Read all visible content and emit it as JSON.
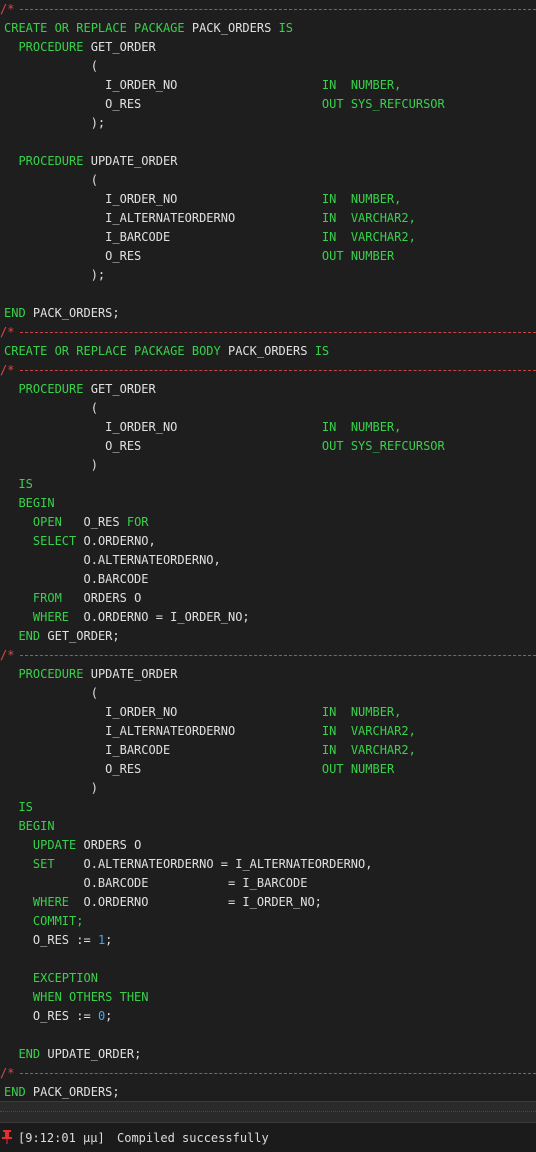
{
  "separator_text": "/*",
  "code": {
    "pkg_header": "CREATE OR REPLACE PACKAGE",
    "pkg_name": "PACK_ORDERS",
    "is": "IS",
    "procedure": "PROCEDURE",
    "get_order": "GET_ORDER",
    "update_order": "UPDATE_ORDER",
    "open_paren": "(",
    "close_paren": ")",
    "close_paren_semi": ");",
    "p_order_no": "I_ORDER_NO",
    "p_o_res": "O_RES",
    "p_alt": "I_ALTERNATEORDERNO",
    "p_barcode": "I_BARCODE",
    "in": "IN",
    "out": "OUT",
    "number_comma": "NUMBER,",
    "number": "NUMBER",
    "varchar2_comma": "VARCHAR2,",
    "sys_refcursor": "SYS_REFCURSOR",
    "end": "END",
    "pack_orders_semi": "PACK_ORDERS;",
    "pkg_body_header": "CREATE OR REPLACE PACKAGE BODY",
    "begin": "BEGIN",
    "open": "OPEN",
    "for": "FOR",
    "select": "SELECT",
    "o_orderno_comma": "O.ORDERNO,",
    "o_alt_comma": "O.ALTERNATEORDERNO,",
    "o_barcode": "O.BARCODE",
    "from": "FROM",
    "orders_o": "ORDERS O",
    "where": "WHERE",
    "where_cond": "O.ORDERNO = I_ORDER_NO;",
    "end_get_order": "GET_ORDER;",
    "update": "UPDATE",
    "set": "SET",
    "set_alt": "O.ALTERNATEORDERNO = I_ALTERNATEORDERNO,",
    "set_barcode": "O.BARCODE           = I_BARCODE",
    "where_upd": "O.ORDERNO           = I_ORDER_NO;",
    "commit": "COMMIT;",
    "assign": "O_RES :=",
    "one": "1",
    "zero": "0",
    "semi": ";",
    "exception": "EXCEPTION",
    "when_others_then": "WHEN OTHERS THEN",
    "end_update_order": "UPDATE_ORDER;"
  },
  "status": {
    "time": "[9:12:01 μμ]",
    "message": "Compiled successfully",
    "icon": "pin-icon"
  },
  "colors": {
    "keyword": "#38d14a",
    "identifier": "#e0e0e0",
    "number": "#3fa9f5",
    "separator": "#d84a4a",
    "background": "#1e1e1e"
  }
}
